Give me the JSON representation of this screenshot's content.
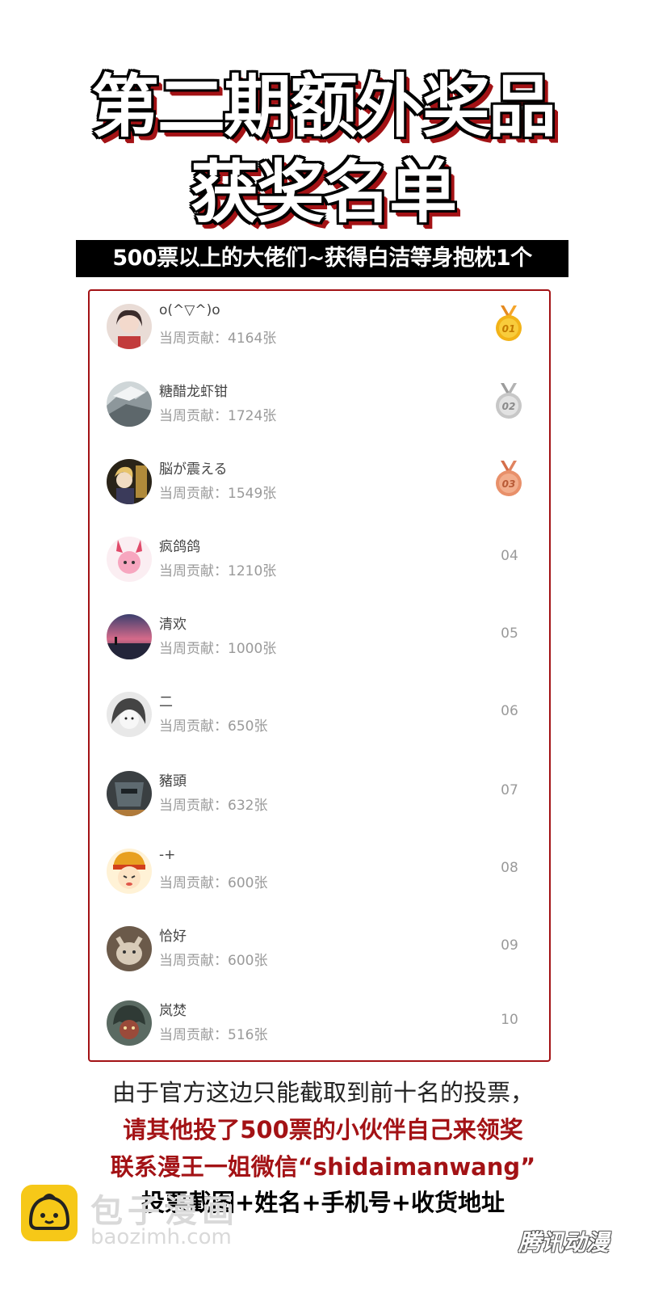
{
  "header": {
    "title_line1": "第二期额外奖品",
    "title_line2": "获奖名单",
    "banner": "500票以上的大佬们~获得白洁等身抱枕1个"
  },
  "leaderboard": {
    "entries": [
      {
        "name": "o(^▽^)o",
        "contribution": "当周贡献：4164张",
        "rank": "01",
        "medal": "gold"
      },
      {
        "name": "糖醋龙虾钳",
        "contribution": "当周贡献：1724张",
        "rank": "02",
        "medal": "silver"
      },
      {
        "name": "脳が震える",
        "contribution": "当周贡献：1549张",
        "rank": "03",
        "medal": "bronze"
      },
      {
        "name": "疯鸽鸽",
        "contribution": "当周贡献：1210张",
        "rank": "04"
      },
      {
        "name": "清欢",
        "contribution": "当周贡献：1000张",
        "rank": "05"
      },
      {
        "name": "二",
        "contribution": "当周贡献：650张",
        "rank": "06"
      },
      {
        "name": "豬頭",
        "contribution": "当周贡献：632张",
        "rank": "07"
      },
      {
        "name": "-+",
        "contribution": "当周贡献：600张",
        "rank": "08"
      },
      {
        "name": "恰好",
        "contribution": "当周贡献：600张",
        "rank": "09"
      },
      {
        "name": "岚焚",
        "contribution": "当周贡献：516张",
        "rank": "10"
      }
    ]
  },
  "footer": {
    "line1": "由于官方这边只能截取到前十名的投票，",
    "line2": "请其他投了500票的小伙伴自己来领奖",
    "line3": "联系漫王一姐微信“shidaimanwang”",
    "line4": "投票截图+姓名+手机号+收货地址"
  },
  "watermark": {
    "cn": "包子漫画",
    "en": "baozimh.com",
    "right": "腾讯动漫"
  },
  "colors": {
    "accent_red": "#a31215",
    "gold": "#f2b318",
    "silver": "#c7c7c7",
    "bronze": "#e8906a"
  }
}
